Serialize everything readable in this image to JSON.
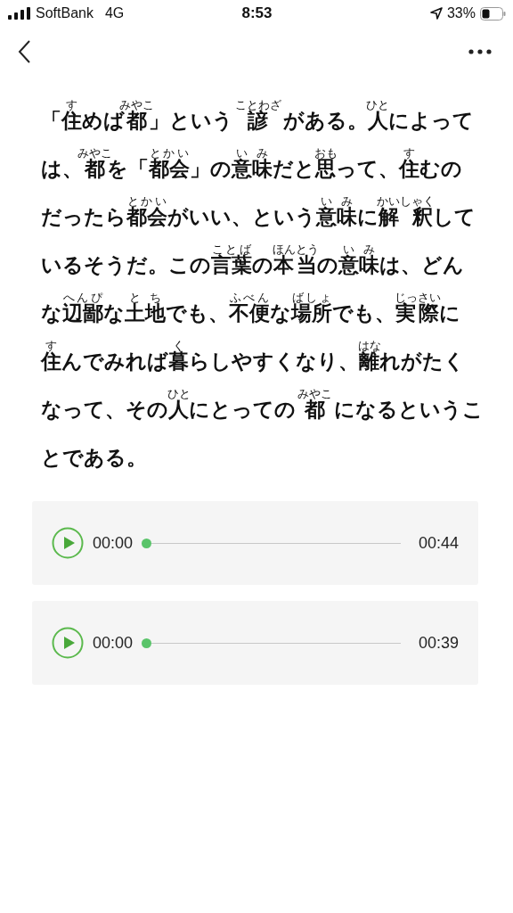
{
  "status_bar": {
    "carrier": "SoftBank",
    "network": "4G",
    "time": "8:53",
    "battery": "33%"
  },
  "passage": {
    "lines": [
      [
        {
          "text": "「"
        },
        {
          "text": "住",
          "ruby": "す"
        },
        {
          "text": "めば"
        },
        {
          "text": "都",
          "ruby": "みやこ"
        },
        {
          "text": "」という "
        },
        {
          "text": "諺",
          "ruby": "ことわざ"
        },
        {
          "text": " がある。"
        },
        {
          "text": "人",
          "ruby": "ひと"
        },
        {
          "text": "によって"
        }
      ],
      [
        {
          "text": "は、"
        },
        {
          "text": "都",
          "ruby": "みやこ"
        },
        {
          "text": "を「"
        },
        {
          "text": "都会",
          "ruby": "とかい"
        },
        {
          "text": "」の"
        },
        {
          "text": "意味",
          "ruby": "いみ"
        },
        {
          "text": "だと"
        },
        {
          "text": "思",
          "ruby": "おも"
        },
        {
          "text": "って、"
        },
        {
          "text": "住",
          "ruby": "す"
        },
        {
          "text": "むの"
        }
      ],
      [
        {
          "text": "だったら"
        },
        {
          "text": "都会",
          "ruby": "とかい"
        },
        {
          "text": "がいい、という"
        },
        {
          "text": "意味",
          "ruby": "いみ"
        },
        {
          "text": "に"
        },
        {
          "text": "解 釈",
          "ruby": "かいしゃく"
        },
        {
          "text": "して"
        }
      ],
      [
        {
          "text": "いるそうだ。この"
        },
        {
          "text": "言葉",
          "ruby": "ことば"
        },
        {
          "text": "の"
        },
        {
          "text": "本当",
          "ruby": "ほんとう"
        },
        {
          "text": "の"
        },
        {
          "text": "意味",
          "ruby": "いみ"
        },
        {
          "text": "は、どん"
        }
      ],
      [
        {
          "text": "な"
        },
        {
          "text": "辺鄙",
          "ruby": "へんぴ"
        },
        {
          "text": "な"
        },
        {
          "text": "土地",
          "ruby": "とち"
        },
        {
          "text": "でも、"
        },
        {
          "text": "不便",
          "ruby": "ふべん"
        },
        {
          "text": "な"
        },
        {
          "text": "場所",
          "ruby": "ばしょ"
        },
        {
          "text": "でも、"
        },
        {
          "text": "実際",
          "ruby": "じっさい"
        },
        {
          "text": "に"
        }
      ],
      [
        {
          "text": "住",
          "ruby": "す"
        },
        {
          "text": "んでみれば"
        },
        {
          "text": "暮",
          "ruby": "く"
        },
        {
          "text": "らしやすくなり、"
        },
        {
          "text": "離",
          "ruby": "はな"
        },
        {
          "text": "れがたく"
        }
      ],
      [
        {
          "text": "なって、その"
        },
        {
          "text": "人",
          "ruby": "ひと"
        },
        {
          "text": "にとっての "
        },
        {
          "text": "都",
          "ruby": "みやこ"
        },
        {
          "text": " になるというこ"
        }
      ],
      [
        {
          "text": "とである。"
        }
      ]
    ]
  },
  "players": [
    {
      "current": "00:00",
      "duration": "00:44",
      "level": 0
    },
    {
      "current": "00:00",
      "duration": "00:39",
      "level": 0
    }
  ]
}
